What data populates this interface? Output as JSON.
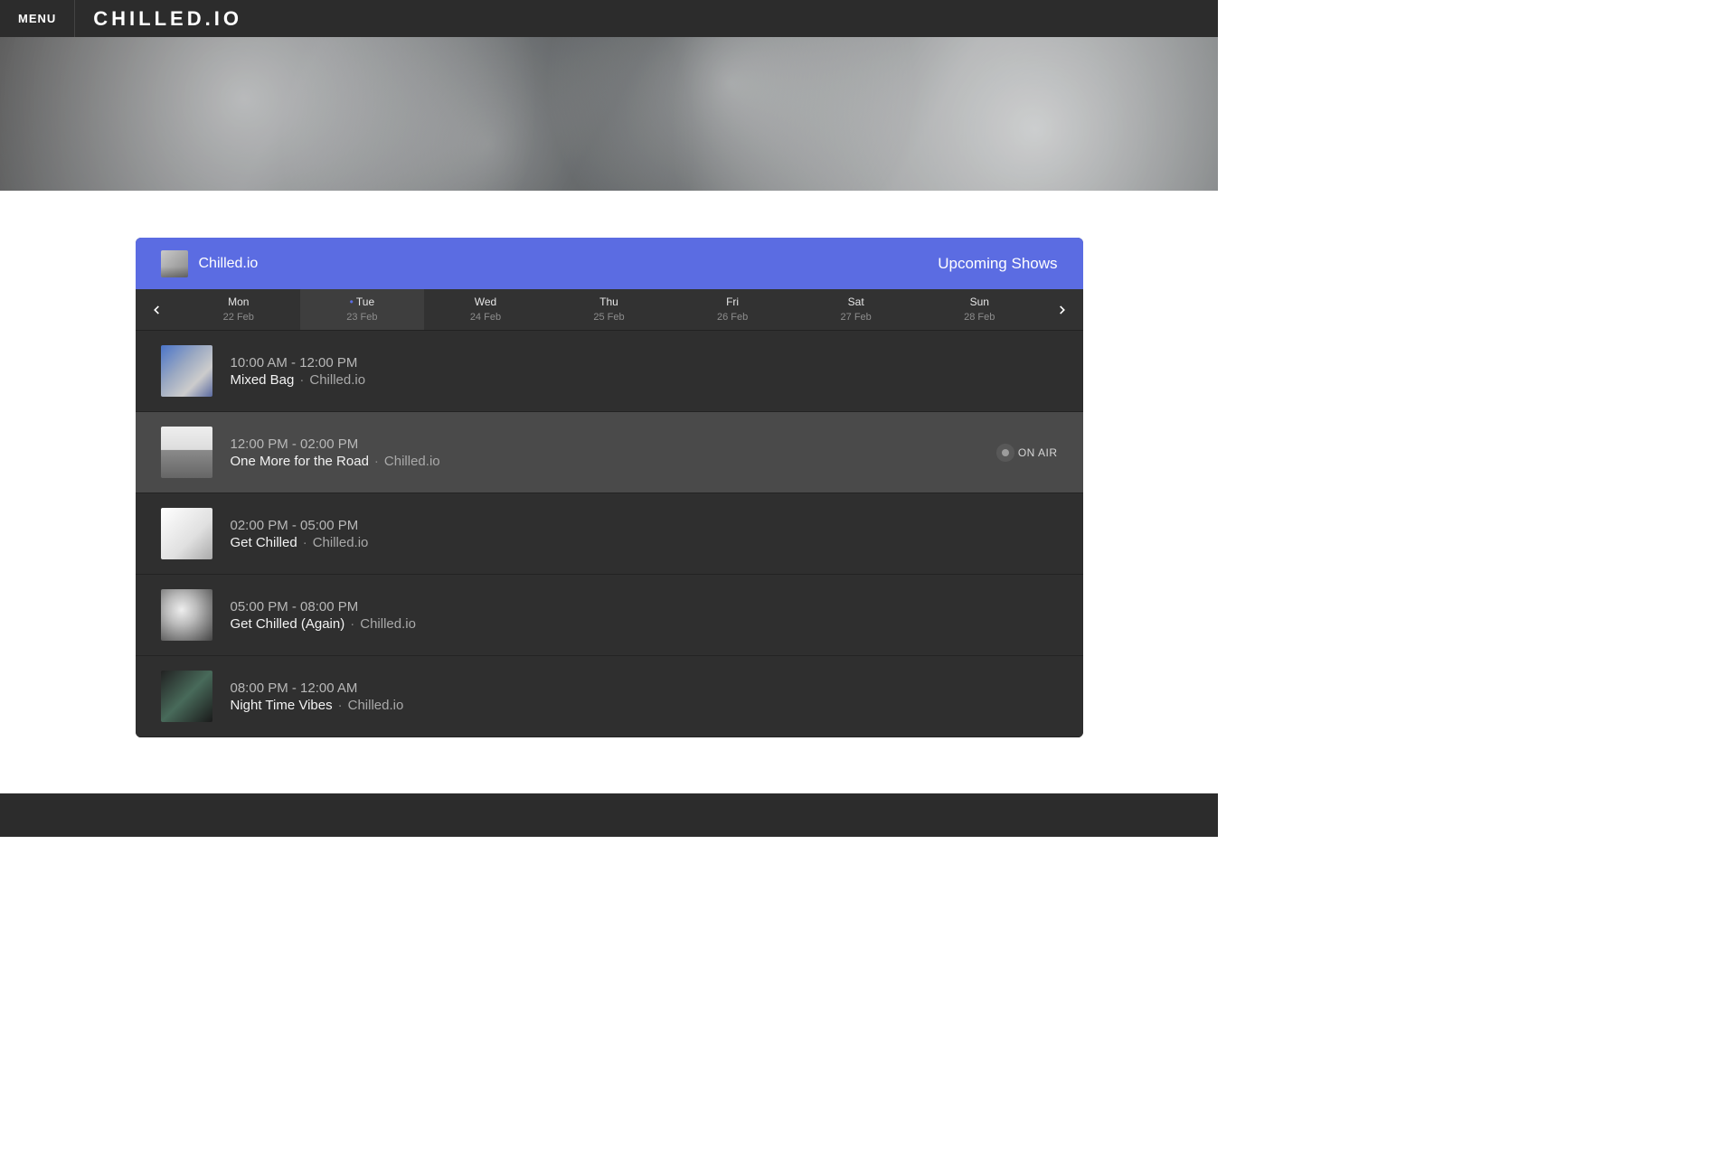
{
  "topbar": {
    "menu_label": "MENU",
    "brand": "CHILLED.IO"
  },
  "station": {
    "name": "Chilled.io",
    "upcoming_label": "Upcoming Shows"
  },
  "days": [
    {
      "dow": "Mon",
      "date": "22 Feb",
      "active": false
    },
    {
      "dow": "Tue",
      "date": "23 Feb",
      "active": true
    },
    {
      "dow": "Wed",
      "date": "24 Feb",
      "active": false
    },
    {
      "dow": "Thu",
      "date": "25 Feb",
      "active": false
    },
    {
      "dow": "Fri",
      "date": "26 Feb",
      "active": false
    },
    {
      "dow": "Sat",
      "date": "27 Feb",
      "active": false
    },
    {
      "dow": "Sun",
      "date": "28 Feb",
      "active": false
    }
  ],
  "shows": [
    {
      "time": "10:00 AM - 12:00 PM",
      "title": "Mixed Bag",
      "station": "Chilled.io",
      "onair": false
    },
    {
      "time": "12:00 PM - 02:00 PM",
      "title": "One More for the Road",
      "station": "Chilled.io",
      "onair": true
    },
    {
      "time": "02:00 PM - 05:00 PM",
      "title": "Get Chilled",
      "station": "Chilled.io",
      "onair": false
    },
    {
      "time": "05:00 PM - 08:00 PM",
      "title": "Get Chilled (Again)",
      "station": "Chilled.io",
      "onair": false
    },
    {
      "time": "08:00 PM - 12:00 AM",
      "title": "Night Time Vibes",
      "station": "Chilled.io",
      "onair": false
    }
  ],
  "onair_label": "ON AIR",
  "separator": "·"
}
